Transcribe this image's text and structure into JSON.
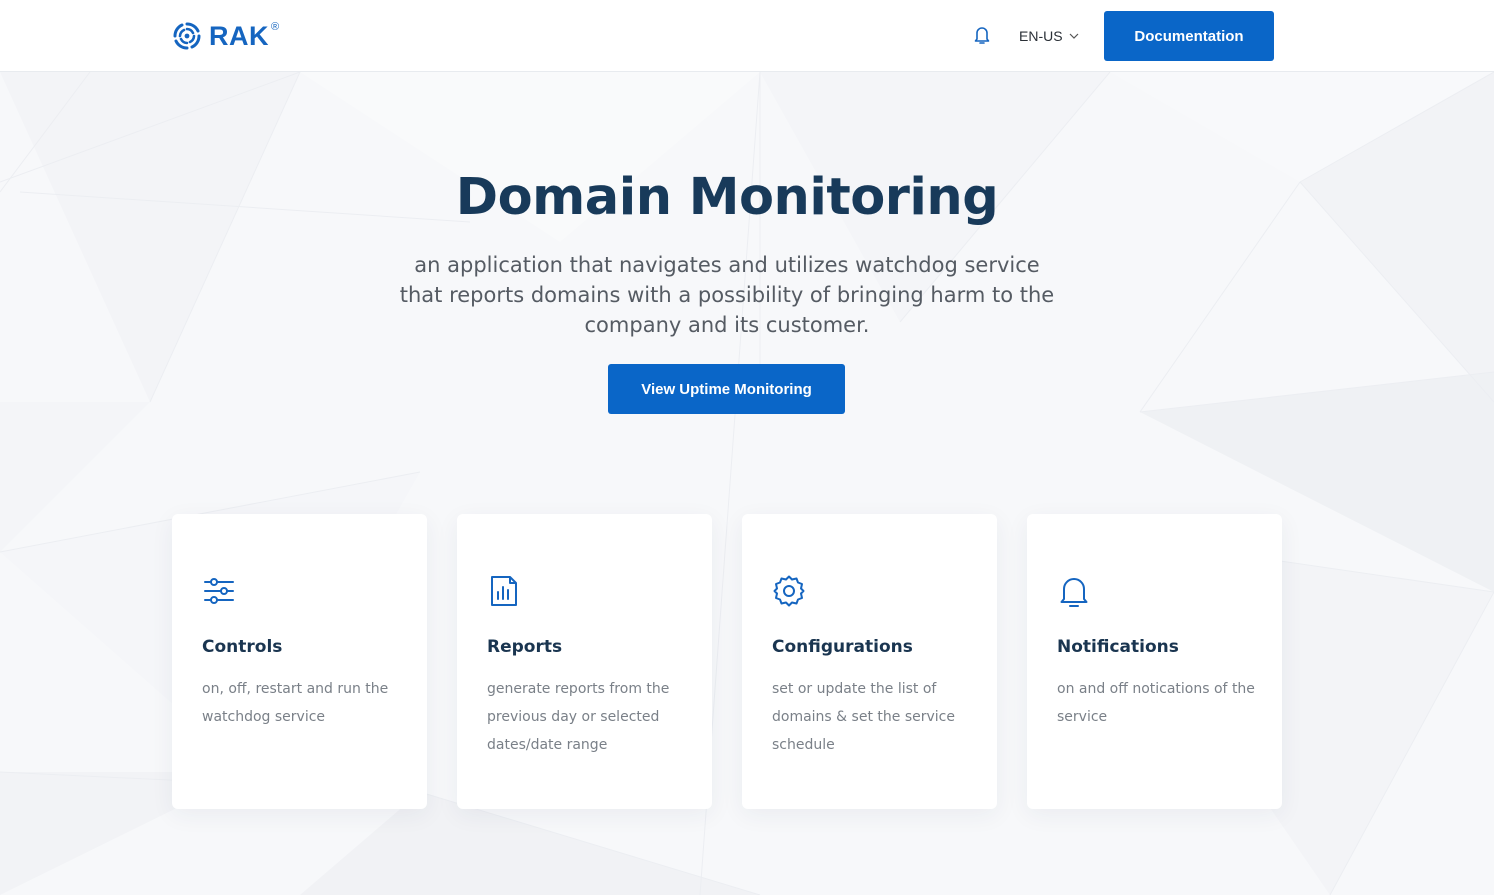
{
  "header": {
    "logo_text": "RAK",
    "logo_reg": "®",
    "language": "EN-US",
    "documentation_label": "Documentation"
  },
  "hero": {
    "title": "Domain Monitoring",
    "subtitle": "an application that navigates and utilizes watchdog service that reports domains with a possibility of bringing harm to the company and its customer.",
    "cta_label": "View Uptime Monitoring"
  },
  "features": [
    {
      "icon": "sliders-icon",
      "title": "Controls",
      "description": "on, off, restart and run the watchdog service"
    },
    {
      "icon": "report-chart-icon",
      "title": "Reports",
      "description": "generate reports from the previous day or selected dates/date range"
    },
    {
      "icon": "gear-icon",
      "title": "Configurations",
      "description": "set or update the list of domains & set the service schedule"
    },
    {
      "icon": "bell-icon",
      "title": "Notifications",
      "description": "on and off notications of the service"
    }
  ],
  "colors": {
    "accent": "#0a66c8",
    "heading": "#183a5a",
    "body_text": "#555b63",
    "muted_text": "#7a8088",
    "background": "#f7f8fa"
  }
}
